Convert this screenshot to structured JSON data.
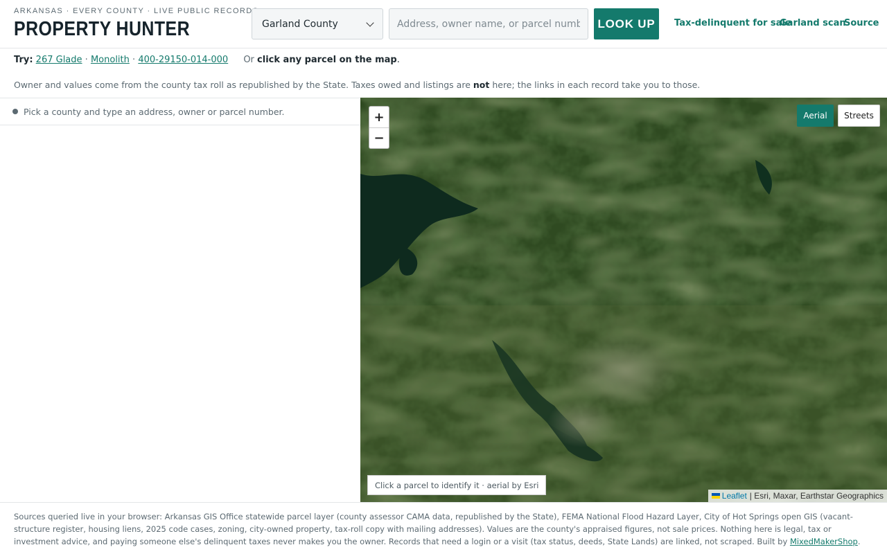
{
  "header": {
    "eyebrow": "ARKANSAS · EVERY COUNTY · LIVE PUBLIC RECORDS",
    "brand": "PROPERTY HUNTER",
    "county_select": "Garland County",
    "search_placeholder": "Address, owner name, or parcel number",
    "lookup_label": "LOOK UP",
    "links": [
      "Tax-delinquent for sale",
      "Garland scan",
      "Source"
    ]
  },
  "try": {
    "label": "Try:",
    "examples": [
      "267 Glade",
      "Monolith",
      "400-29150-014-000"
    ],
    "separator": "·",
    "or_text": "Or",
    "or_bold": "click any parcel on the map",
    "or_end": "."
  },
  "note": {
    "before": "Owner and values come from the county tax roll as republished by the State. Taxes owed and listings are",
    "bold": "not",
    "after": "here; the links in each record take you to those."
  },
  "left_panel": {
    "status": "Pick a county and type an address, owner or parcel number."
  },
  "map": {
    "zoom_in": "+",
    "zoom_out": "−",
    "layers": [
      "Aerial",
      "Streets"
    ],
    "active_layer": "Aerial",
    "hint": "Click a parcel to identify it · aerial by Esri",
    "attribution_leaflet": "Leaflet",
    "attribution_rest": "| Esri, Maxar, Earthstar Geographics"
  },
  "footer": {
    "text": "Sources queried live in your browser: Arkansas GIS Office statewide parcel layer (county assessor CAMA data, republished by the State), FEMA National Flood Hazard Layer, City of Hot Springs open GIS (vacant-structure register, housing liens, 2025 code cases, zoning, city-owned property, tax-roll copy with mailing addresses). Values are the county's appraised figures, not sale prices. Nothing here is legal, tax or investment advice, and paying someone else's delinquent taxes never makes you the owner. Records that need a login or a visit (tax status, deeds, State Lands) are linked, not scraped. Built by",
    "link": "MixedMakerShop",
    "end": "."
  },
  "colors": {
    "accent": "#147a6c",
    "map_dark": "#2c4520",
    "water": "#0e2a1e"
  }
}
